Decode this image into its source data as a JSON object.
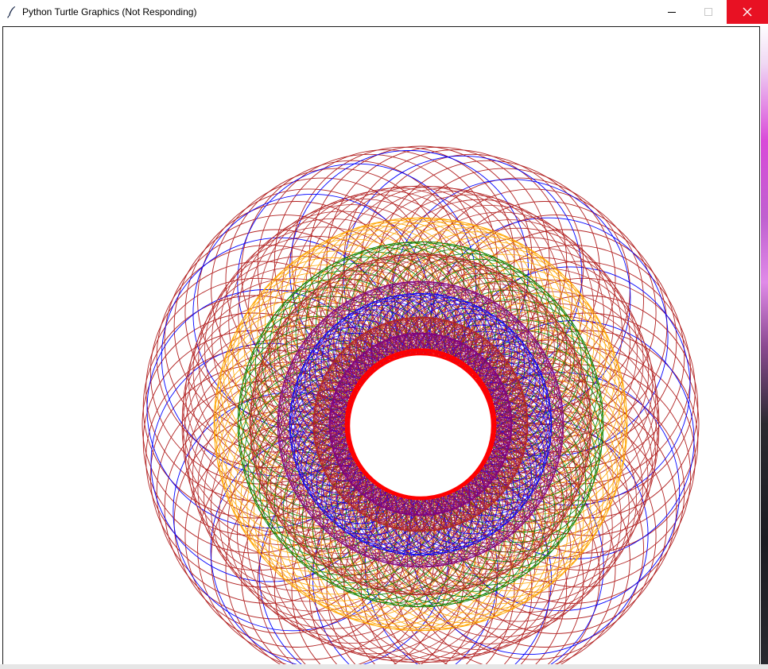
{
  "window": {
    "title": "Python Turtle Graphics (Not Responding)",
    "app_icon": "feather-pen-icon",
    "controls": {
      "minimize_icon": "minimize-icon",
      "maximize_icon": "maximize-icon",
      "close_icon": "close-icon",
      "close_color": "#e81123"
    }
  },
  "canvas": {
    "background": "#ffffff",
    "drawing": "spirograph",
    "pen_colors": [
      "#b22222",
      "#0000ff",
      "#ffa500",
      "#008000",
      "#800080",
      "#ff0000"
    ]
  }
}
